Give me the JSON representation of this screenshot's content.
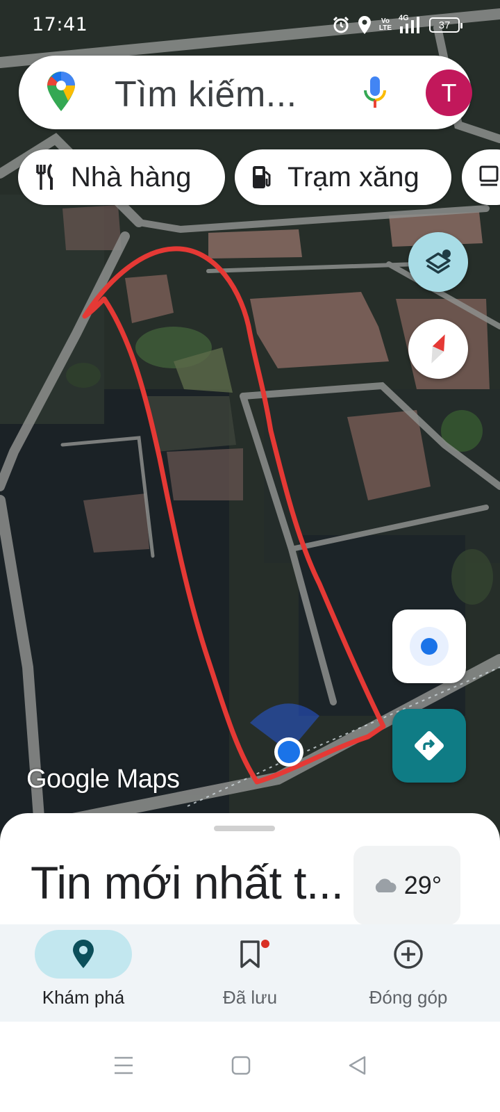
{
  "status_bar": {
    "time": "17:41",
    "volte_line1": "Vo",
    "volte_line2": "LTE",
    "network": "4G",
    "battery": "37"
  },
  "search": {
    "placeholder": "Tìm kiếm...",
    "avatar_letter": "T"
  },
  "chips": [
    {
      "label": "Nhà hàng",
      "icon": "restaurant-icon"
    },
    {
      "label": "Trạm xăng",
      "icon": "gas-station-icon"
    }
  ],
  "map": {
    "watermark": "Google Maps",
    "layer_button_icon": "layers-icon",
    "compass_icon": "compass-icon",
    "location_icon": "my-location-icon",
    "directions_icon": "directions-icon",
    "outline_color": "#e53935"
  },
  "sheet": {
    "title": "Tin mới nhất t...",
    "weather_temp": "29°",
    "weather_icon": "cloud-icon"
  },
  "nav": [
    {
      "label": "Khám phá",
      "icon": "explore-pin-icon",
      "active": true
    },
    {
      "label": "Đã lưu",
      "icon": "bookmark-icon",
      "active": false
    },
    {
      "label": "Đóng góp",
      "icon": "add-circle-icon",
      "active": false
    }
  ],
  "colors": {
    "accent": "#0f7c85",
    "avatar": "#c2185b",
    "location_dot": "#1a73e8"
  }
}
